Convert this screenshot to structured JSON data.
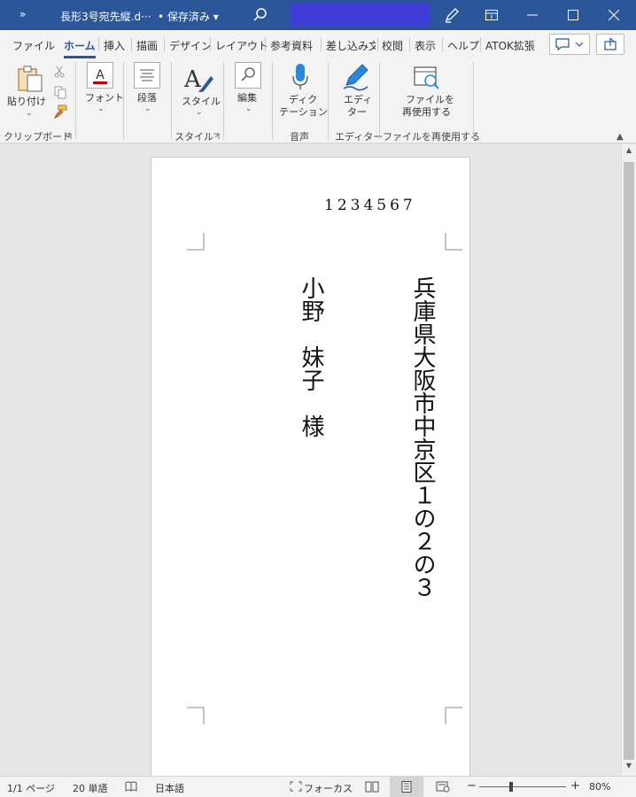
{
  "titlebar": {
    "quick_access": "»",
    "doc_name": "長形3号宛先縦.d···",
    "save_state": "• 保存済み ▾"
  },
  "tabs": [
    "ファイル",
    "ホーム",
    "挿入",
    "描画",
    "デザイン",
    "レイアウト",
    "参考資料",
    "差し込み文",
    "校閲",
    "表示",
    "ヘルプ",
    "ATOK拡張"
  ],
  "ribbon": {
    "paste": "貼り付け",
    "font": "フォント",
    "paragraph": "段落",
    "styles": "スタイル",
    "editing": "編集",
    "dictate_1": "ディク",
    "dictate_2": "テーション",
    "editor_1": "エディ",
    "editor_2": "ター",
    "reuse_1": "ファイルを",
    "reuse_2": "再使用する",
    "groups": {
      "clipboard": "クリップボード",
      "styles": "スタイル",
      "voice": "音声",
      "editor": "エディター",
      "reuse": "ファイルを再使用する"
    }
  },
  "document": {
    "postal_code": "1234567",
    "address": "兵庫県大阪市中京区１の２の３",
    "recipient": "小野　妹子　様"
  },
  "statusbar": {
    "page": "1/1 ページ",
    "words": "20 単語",
    "language": "日本語",
    "focus": "フォーカス",
    "zoom": "80%"
  }
}
